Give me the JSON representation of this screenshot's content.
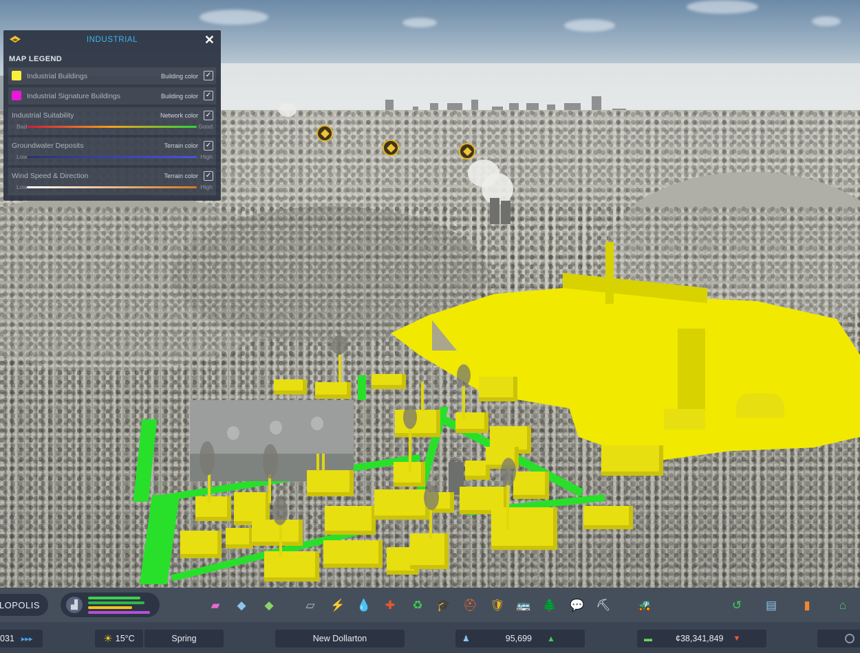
{
  "legend": {
    "title": "INDUSTRIAL",
    "subtitle": "MAP LEGEND",
    "close_symbol": "✕",
    "items": [
      {
        "label": "Industrial Buildings",
        "mode": "Building color",
        "color": "#f7ef3c",
        "checked": true
      },
      {
        "label": "Industrial Signature Buildings",
        "mode": "Building color",
        "color": "#ea18d8",
        "checked": true
      }
    ],
    "gradients": [
      {
        "label": "Industrial Suitability",
        "mode": "Network color",
        "low": "Bad",
        "high": "Good",
        "colors": [
          "#d21b3c",
          "#f3a21a",
          "#2fd43a"
        ],
        "checked": true
      },
      {
        "label": "Groundwater Deposits",
        "mode": "Terrain color",
        "low": "Low",
        "high": "High",
        "colors": [
          "#2a3370",
          "#4453e6"
        ],
        "checked": true
      },
      {
        "label": "Wind Speed & Direction",
        "mode": "Terrain color",
        "low": "Low",
        "high": "High",
        "colors": [
          "#ffffff",
          "#d47a1e"
        ],
        "checked": true
      }
    ]
  },
  "city": {
    "name": "ALOPOLIS"
  },
  "toolbar": {
    "tools": [
      {
        "name": "zoning-icon",
        "glyph": "▰",
        "color": "#e86ad0"
      },
      {
        "name": "areas-icon",
        "glyph": "◆",
        "color": "#8fc4ea"
      },
      {
        "name": "landscaping-icon",
        "glyph": "◆",
        "color": "#8cd46a"
      },
      {
        "name": "roads-icon",
        "glyph": "▱",
        "color": "#b8bec8"
      },
      {
        "name": "electricity-icon",
        "glyph": "⚡",
        "color": "#f2c21b"
      },
      {
        "name": "water-icon",
        "glyph": "💧",
        "color": "#36a4ea"
      },
      {
        "name": "health-icon",
        "glyph": "✚",
        "color": "#f0562c"
      },
      {
        "name": "garbage-icon",
        "glyph": "♻",
        "color": "#3fcf52"
      },
      {
        "name": "education-icon",
        "glyph": "🎓",
        "color": "#7aa4d8"
      },
      {
        "name": "fire-icon",
        "glyph": "⛑",
        "color": "#f0642c"
      },
      {
        "name": "police-icon",
        "glyph": "🛡",
        "color": "#f2b41b"
      },
      {
        "name": "transport-icon",
        "glyph": "🚌",
        "color": "#3fcf52"
      },
      {
        "name": "parks-icon",
        "glyph": "🌲",
        "color": "#3fcf52"
      },
      {
        "name": "communications-icon",
        "glyph": "💬",
        "color": "#e8ecf2"
      },
      {
        "name": "landscape-tool-icon",
        "glyph": "⛏",
        "color": "#e8ecf2"
      },
      {
        "name": "bulldozer-icon",
        "glyph": "🚜",
        "color": "#f2b41b"
      }
    ],
    "right_tools": [
      {
        "name": "undo-icon",
        "glyph": "↺",
        "color": "#3fcf52"
      },
      {
        "name": "map-icon",
        "glyph": "▤",
        "color": "#8fc4ea"
      },
      {
        "name": "statistics-icon",
        "glyph": "▮",
        "color": "#f0882c"
      },
      {
        "name": "home-icon",
        "glyph": "⌂",
        "color": "#3fcf52"
      }
    ]
  },
  "status": {
    "date_fragment": "031",
    "speed_symbol": "▸▸▸",
    "temperature": "15°C",
    "season": "Spring",
    "district": "New Dollarton",
    "population": "95,699",
    "money": "¢38,341,849"
  }
}
